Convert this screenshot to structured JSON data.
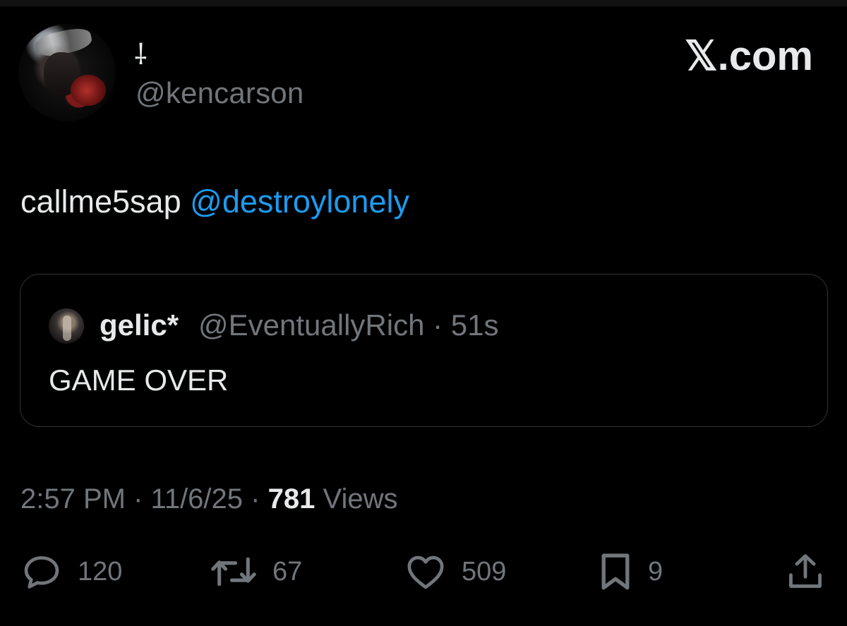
{
  "author": {
    "display_name": "⸸",
    "handle": "@kencarson"
  },
  "brand": "𝕏.com",
  "tweet": {
    "text": "callme5sap",
    "mention": "@destroylonely"
  },
  "quote": {
    "name": "gelic*",
    "handle": "@EventuallyRich",
    "separator": "·",
    "age": "51s",
    "text": "GAME OVER"
  },
  "meta": {
    "time": "2:57 PM",
    "date": "11/6/25",
    "separator": "·",
    "views_count": "781",
    "views_label": "Views"
  },
  "actions": {
    "replies": "120",
    "reposts": "67",
    "likes": "509",
    "bookmarks": "9"
  },
  "icons": {
    "reply": "reply-icon",
    "repost": "repost-icon",
    "like": "heart-icon",
    "bookmark": "bookmark-icon",
    "share": "share-icon"
  },
  "colors": {
    "background": "#000000",
    "text": "#e7e9ea",
    "muted": "#71767b",
    "link": "#1d9bf0",
    "border": "#2f3336"
  }
}
